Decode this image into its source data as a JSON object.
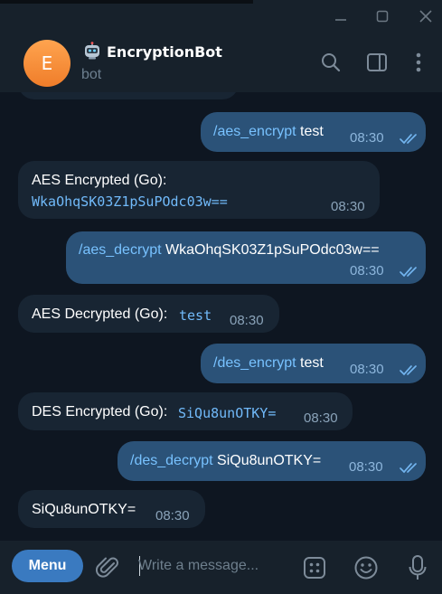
{
  "window": {
    "controls": [
      "minimize-icon",
      "maximize-icon",
      "close-icon"
    ]
  },
  "header": {
    "avatar_letter": "E",
    "title_icon": "robot-icon",
    "title": "EncryptionBot",
    "status": "bot",
    "actions": [
      "search-icon",
      "sidebar-toggle-icon",
      "more-vertical-icon"
    ]
  },
  "messages": [
    {
      "dir": "out",
      "command": "/aes_encrypt",
      "text": " test",
      "time": "08:30",
      "read": true
    },
    {
      "dir": "in",
      "label": "AES Encrypted (Go):",
      "code": "WkaOhqSK03Z1pSuPOdc03w==",
      "time": "08:30"
    },
    {
      "dir": "out",
      "command": "/aes_decrypt",
      "text": " WkaOhqSK03Z1pSuPOdc03w==",
      "time": "08:30",
      "read": true
    },
    {
      "dir": "in",
      "label": "AES Decrypted (Go): ",
      "code": "test",
      "time": "08:30"
    },
    {
      "dir": "out",
      "command": "/des_encrypt",
      "text": " test",
      "time": "08:30",
      "read": true
    },
    {
      "dir": "in",
      "label": "DES Encrypted (Go): ",
      "code": "SiQu8unOTKY=",
      "time": "08:30"
    },
    {
      "dir": "out",
      "command": "/des_decrypt",
      "text": " SiQu8unOTKY=",
      "time": "08:30",
      "read": true
    },
    {
      "dir": "in",
      "label": "SiQu8unOTKY=",
      "time": "08:30"
    }
  ],
  "composer": {
    "menu_label": "Menu",
    "placeholder": "Write a message...",
    "icons": [
      "attach-icon",
      "bot-commands-icon",
      "emoji-icon",
      "microphone-icon"
    ]
  },
  "colors": {
    "background": "#0e1621",
    "panel": "#17212b",
    "incoming": "#182533",
    "outgoing": "#2b5278",
    "accent": "#3a7ac0",
    "link": "#78c2ff"
  }
}
